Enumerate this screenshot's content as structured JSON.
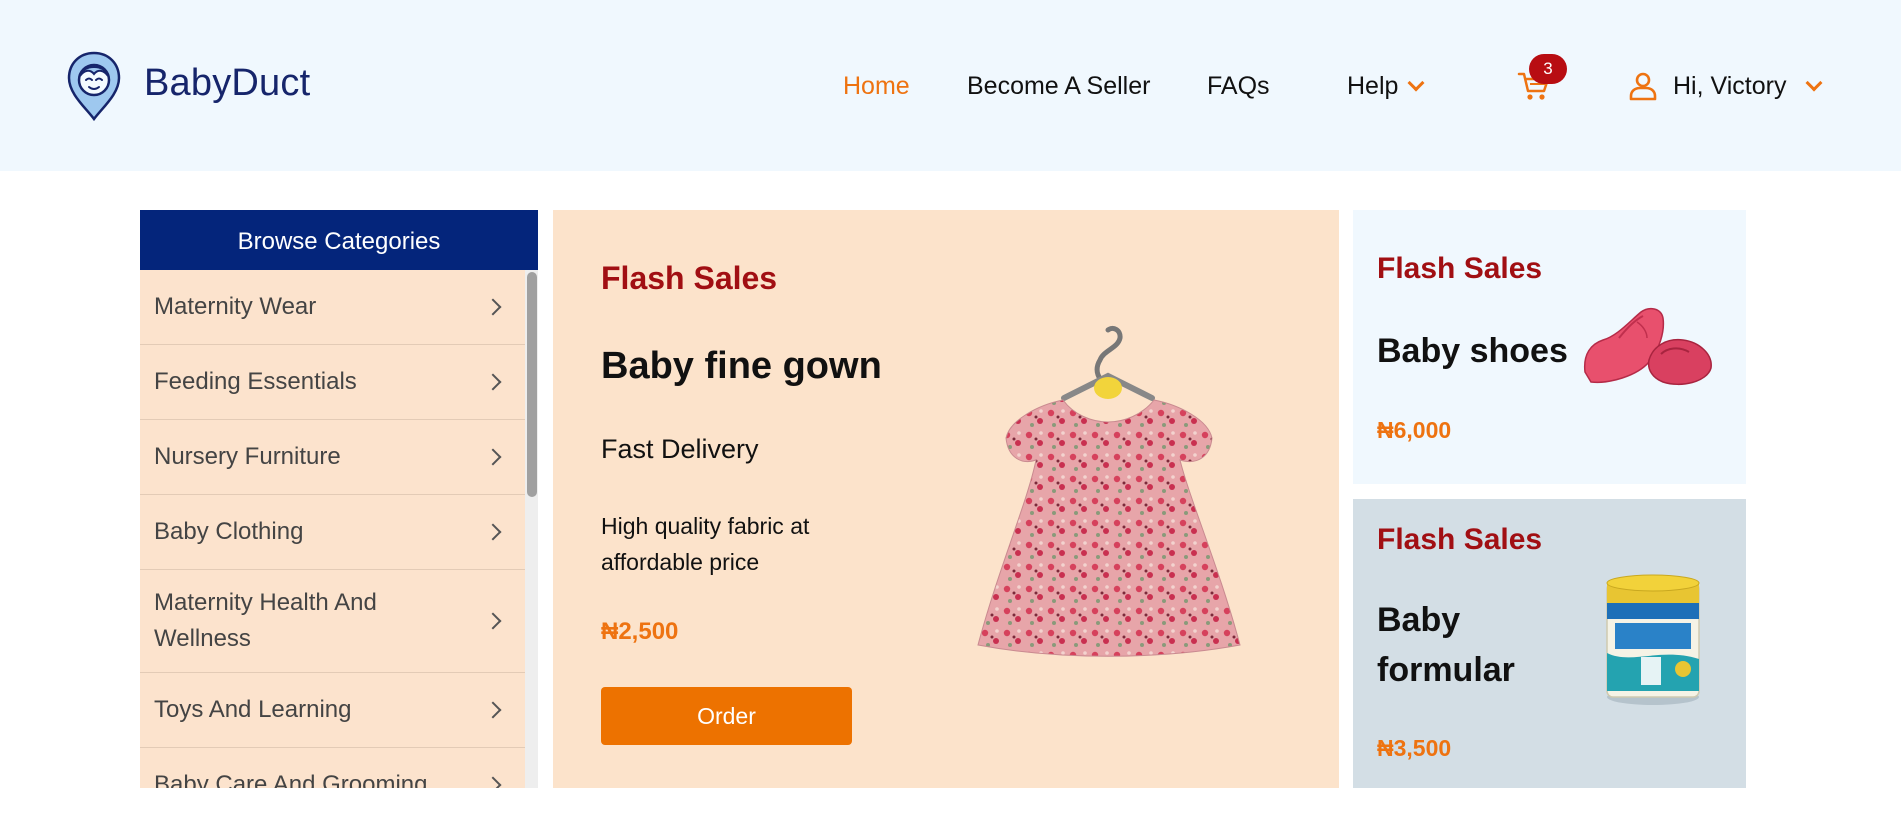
{
  "header": {
    "brand": "BabyDuct",
    "nav": [
      "Home",
      "Become A Seller",
      "FAQs",
      "Help"
    ],
    "cart_count": "3",
    "user_greeting": "Hi, Victory"
  },
  "sidebar": {
    "heading": "Browse Categories",
    "items": [
      "Maternity Wear",
      "Feeding Essentials",
      "Nursery Furniture",
      "Baby Clothing",
      "Maternity Health And Wellness",
      "Toys And Learning",
      "Baby Care And Grooming"
    ]
  },
  "banner": {
    "flash_label": "Flash Sales",
    "title": "Baby fine gown",
    "subtitle": "Fast Delivery",
    "description": "High quality fabric at affordable price",
    "price": "₦2,500",
    "order_label": "Order"
  },
  "cards": [
    {
      "flash_label": "Flash Sales",
      "name": "Baby shoes",
      "price": "₦6,000"
    },
    {
      "flash_label": "Flash Sales",
      "name": "Baby formular",
      "price": "₦3,500"
    }
  ],
  "colors": {
    "accent": "#ee7311",
    "brand_navy": "#04257b",
    "flash_red": "#a10f13",
    "badge_red": "#b80d12"
  }
}
